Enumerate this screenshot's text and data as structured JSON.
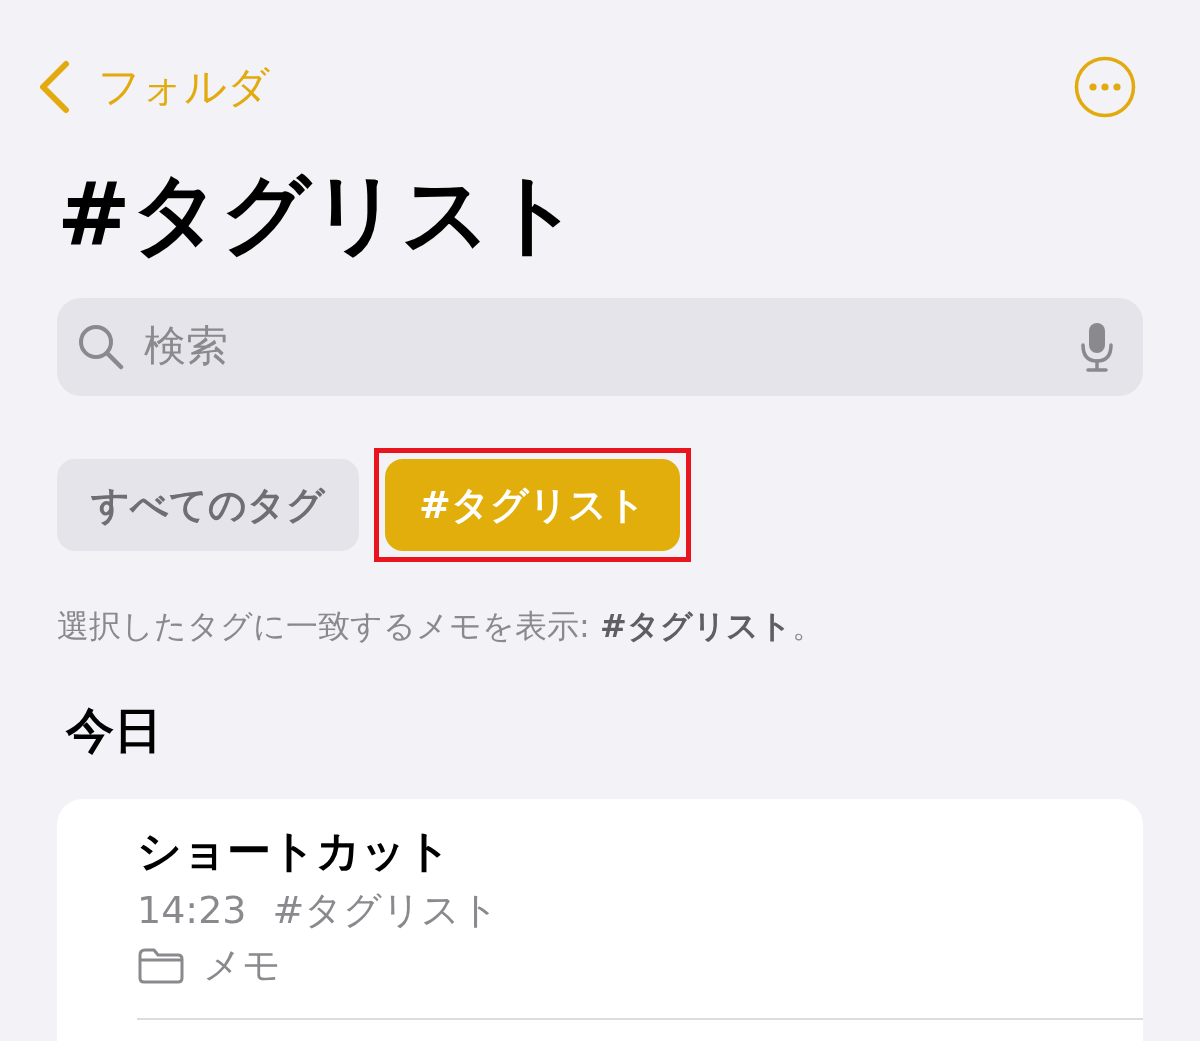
{
  "nav": {
    "back_label": "フォルダ"
  },
  "title": "#タグリスト",
  "search": {
    "placeholder": "検索"
  },
  "tags": [
    {
      "label": "すべてのタグ",
      "selected": false,
      "highlighted": false
    },
    {
      "label": "#タグリスト",
      "selected": true,
      "highlighted": true
    }
  ],
  "filter_note": "選択したタグに一致するメモを表示: **#タグリスト**。",
  "sections": [
    {
      "heading": "今日",
      "notes": [
        {
          "title": "ショートカット",
          "time": "14:23",
          "tags": "#タグリスト",
          "folder": "メモ"
        }
      ]
    }
  ]
}
